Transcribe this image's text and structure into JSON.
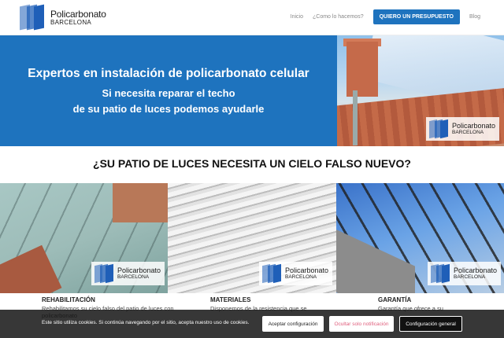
{
  "brand": {
    "name_line1": "Policarbonato",
    "name_line2": "BARCELONA",
    "color": "#1f5fb8"
  },
  "nav": {
    "items": [
      "Inicio",
      "¿Como lo hacemos?"
    ],
    "cta": "QUIERO UN PRESUPUESTO",
    "last": "Blog",
    "cta_color": "#1e73be"
  },
  "hero": {
    "title": "Expertos en instalación de policarbonato celular",
    "subtitle_line1": "Si necesita reparar el techo",
    "subtitle_line2": "de su patio de luces podemos ayudarle",
    "background": "#1e73be",
    "badge": {
      "line1": "Policarbonato",
      "line2": "BARCELONA"
    }
  },
  "section": {
    "title": "¿SU PATIO DE LUCES NECESITA UN CIELO FALSO NUEVO?"
  },
  "gallery": [
    {
      "badge_line1": "Policarbonato",
      "badge_line2": "BARCELONA"
    },
    {
      "badge_line1": "Policarbonato",
      "badge_line2": "BARCELONA"
    },
    {
      "badge_line1": "Policarbonato",
      "badge_line2": "BARCELONA"
    }
  ],
  "cards": [
    {
      "label": "REHABILITACIÓN",
      "body": "Rehabilitamos su cielo falso del patio de luces con policarbonato"
    },
    {
      "label": "MATERIALES",
      "body": "Disponemos de la resistencia que se"
    },
    {
      "label": "GARANTÍA",
      "body": "Garantía que ofrece a su"
    }
  ],
  "cookie": {
    "text": "Este sitio utiliza cookies. Si continúa navegando por el sitio, acepta nuestro uso de cookies.",
    "accept": "Aceptar configuración",
    "hide": "Ocultar solo notificación",
    "config": "Configuración general"
  }
}
